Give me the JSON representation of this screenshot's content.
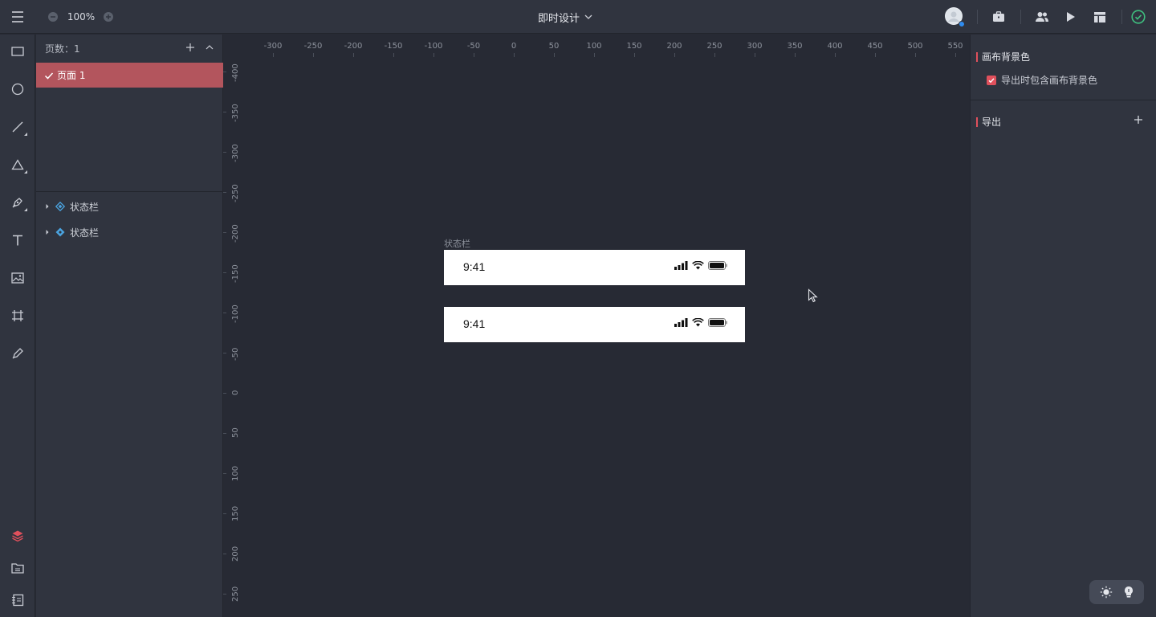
{
  "topbar": {
    "zoom": "100%",
    "project_title": "即时设计",
    "icons": [
      "menu-icon",
      "zoom-out-icon",
      "zoom-in-icon",
      "chevron-down-icon",
      "briefcase-icon",
      "users-icon",
      "play-icon",
      "layout-icon",
      "check-circle-icon"
    ]
  },
  "left_tools": [
    "rectangle-icon",
    "ellipse-icon",
    "line-icon",
    "triangle-icon",
    "pen-icon",
    "text-icon",
    "image-icon",
    "artboard-icon",
    "pencil-icon",
    "layers-icon",
    "assets-icon",
    "components-icon"
  ],
  "pages": {
    "count_label": "页数：1",
    "items": [
      {
        "label": "页面 1",
        "selected": true
      }
    ]
  },
  "layers": [
    {
      "label": "状态栏",
      "icon": "component-outline-icon"
    },
    {
      "label": "状态栏",
      "icon": "component-filled-icon"
    }
  ],
  "canvas": {
    "ruler_x": [
      "-300",
      "-250",
      "-200",
      "-150",
      "-100",
      "-50",
      "0",
      "50",
      "100",
      "150",
      "200",
      "250",
      "300",
      "350",
      "400",
      "450",
      "500",
      "550"
    ],
    "ruler_y": [
      "-400",
      "-350",
      "-300",
      "-250",
      "-200",
      "-150",
      "-100",
      "-50",
      "0",
      "50",
      "100",
      "150",
      "200",
      "250"
    ],
    "artboard_label": "状态栏",
    "statusbars": [
      {
        "time": "9:41"
      },
      {
        "time": "9:41"
      }
    ]
  },
  "right_panel": {
    "canvas_bg_title": "画布背景色",
    "include_bg_label": "导出时包含画布背景色",
    "include_bg_checked": true,
    "export_title": "导出"
  },
  "colors": {
    "accent": "#e0505c",
    "selected_page": "#b3555d",
    "component_blue": "#4aa3df",
    "status_ok": "#3fbf7f"
  }
}
